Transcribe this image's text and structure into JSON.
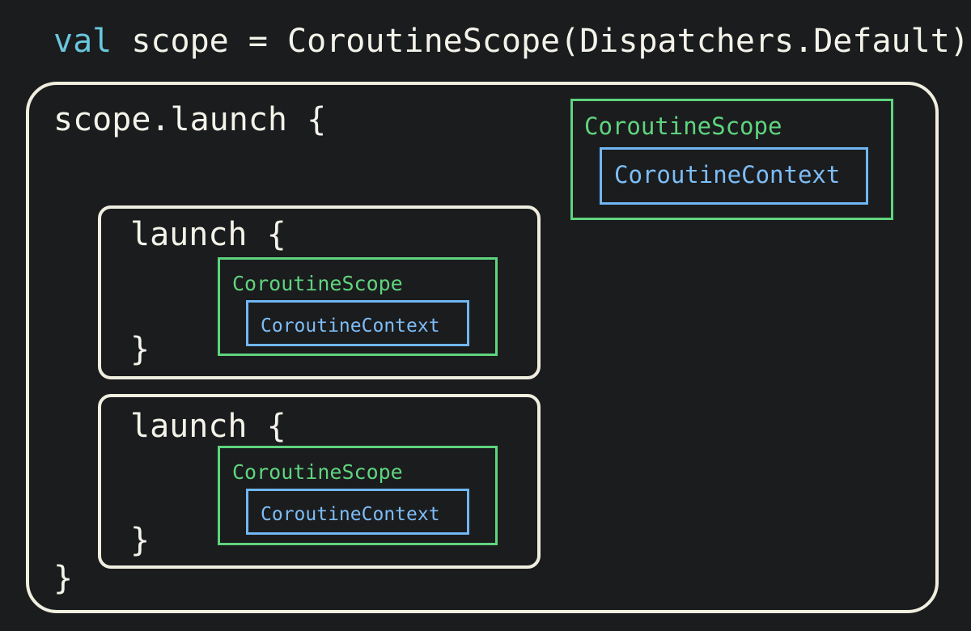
{
  "header": {
    "keyword": "val",
    "rest": " scope = CoroutineScope(Dispatchers.Default)"
  },
  "outer_block": {
    "open": "scope.launch {",
    "close": "}",
    "scope_label": "CoroutineScope",
    "context_label": "CoroutineContext"
  },
  "child_blocks": [
    {
      "open": "launch {",
      "close": "}",
      "scope_label": "CoroutineScope",
      "context_label": "CoroutineContext"
    },
    {
      "open": "launch {",
      "close": "}",
      "scope_label": "CoroutineScope",
      "context_label": "CoroutineContext"
    }
  ],
  "colors": {
    "background": "#1b1c1e",
    "code_text": "#f4f3ea",
    "keyword": "#6ac6dc",
    "block_border": "#f0eedf",
    "scope": "#5fd47e",
    "context": "#71b6f5"
  }
}
